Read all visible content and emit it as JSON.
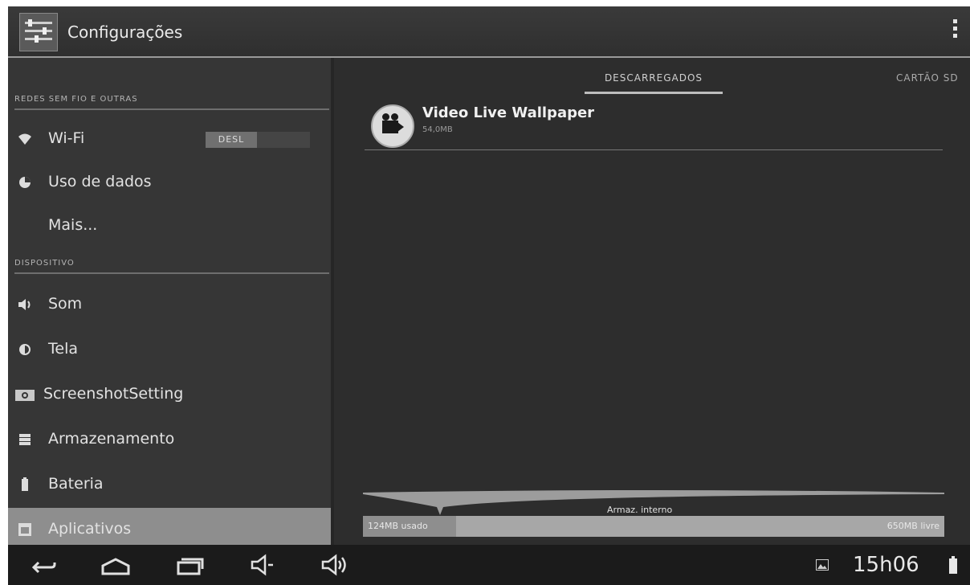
{
  "header": {
    "title": "Configurações",
    "settings_icon": "settings-sliders-icon",
    "menu_icon": "overflow-menu-icon"
  },
  "sidebar": {
    "sections": [
      {
        "header": "REDES SEM FIO E OUTRAS"
      },
      {
        "header": "DISPOSITIVO"
      }
    ],
    "items": [
      {
        "label": "Wi-Fi",
        "icon": "wifi-icon",
        "toggle": "DESL"
      },
      {
        "label": "Uso de dados",
        "icon": "data-usage-icon"
      },
      {
        "label": "Mais..."
      },
      {
        "label": "Som",
        "icon": "speaker-icon"
      },
      {
        "label": "Tela",
        "icon": "brightness-icon"
      },
      {
        "label": "ScreenshotSetting",
        "icon": "camera-icon"
      },
      {
        "label": "Armazenamento",
        "icon": "storage-icon"
      },
      {
        "label": "Bateria",
        "icon": "battery-icon"
      },
      {
        "label": "Aplicativos",
        "icon": "apps-icon",
        "selected": true
      }
    ]
  },
  "main": {
    "tabs": [
      {
        "label": "DESCARREGADOS",
        "active": true
      },
      {
        "label": "CARTÃO SD"
      }
    ],
    "apps": [
      {
        "name": "Video Live Wallpaper",
        "size": "54,0MB",
        "icon": "video-camera-icon"
      }
    ],
    "storage": {
      "label": "Armaz. interno",
      "used": "124MB usado",
      "free": "650MB livre",
      "used_fraction": 0.16
    }
  },
  "navbar": {
    "back_icon": "back-icon",
    "home_icon": "home-icon",
    "recents_icon": "recent-apps-icon",
    "volume_down_icon": "volume-down-icon",
    "volume_up_icon": "volume-up-icon",
    "gallery_icon": "gallery-icon",
    "time": "15h06",
    "battery_icon": "battery-icon"
  }
}
